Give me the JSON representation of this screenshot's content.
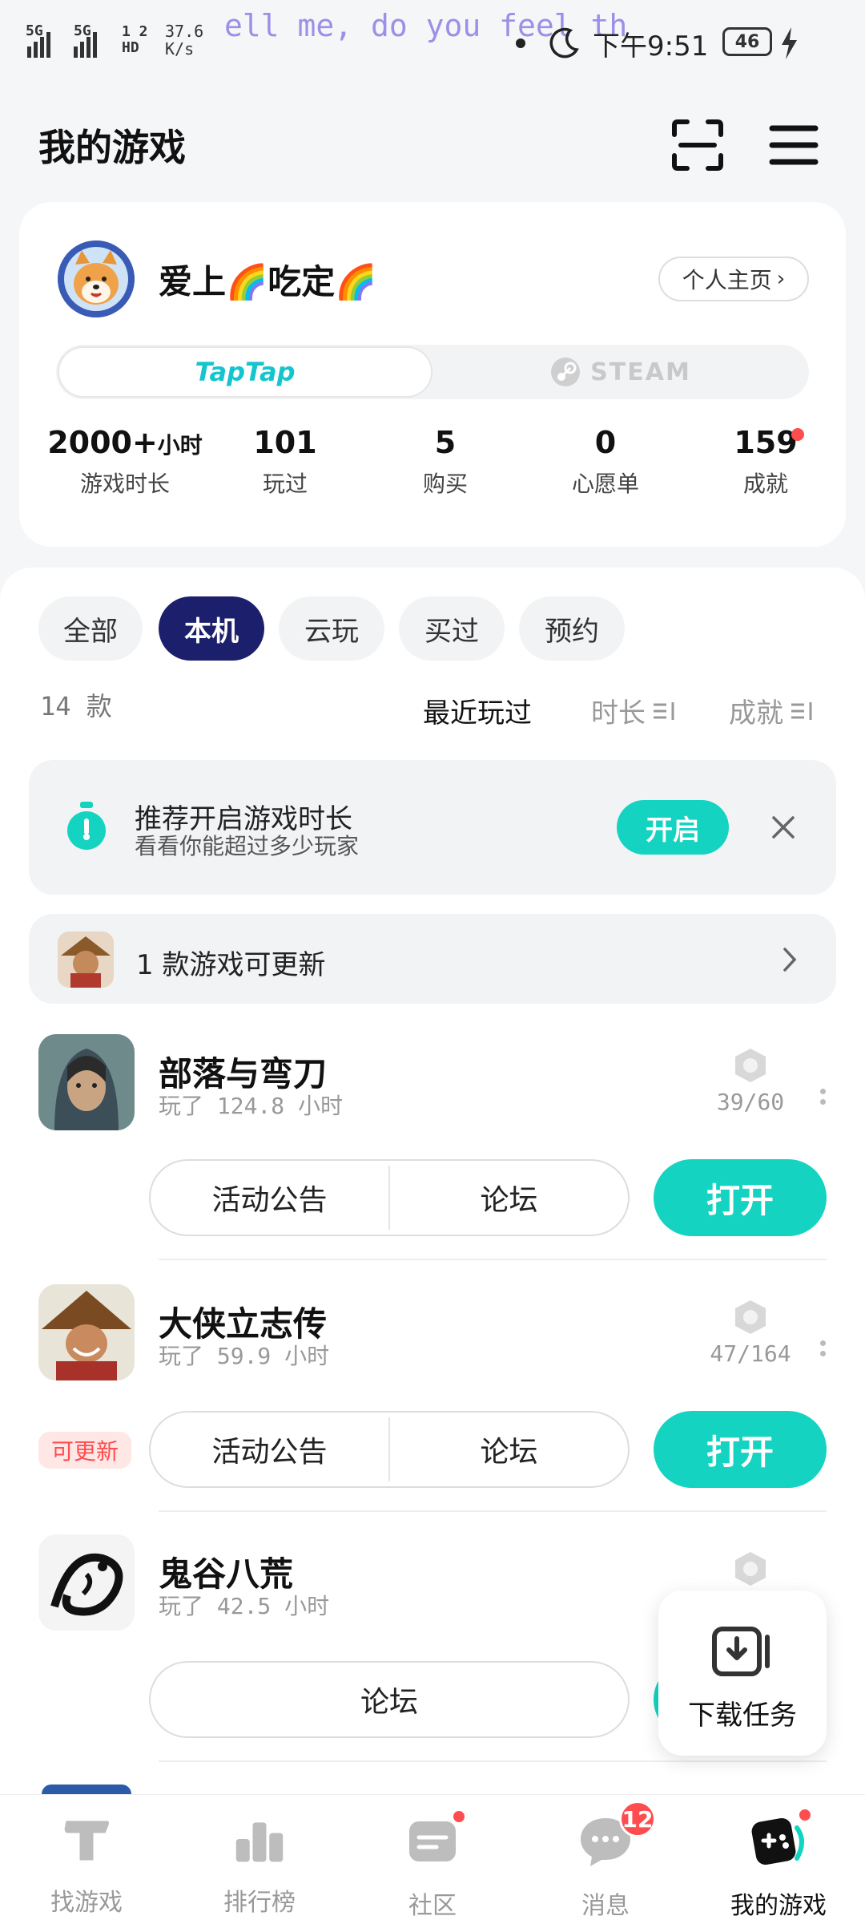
{
  "status_bar": {
    "signal_1": "5G",
    "signal_2": "5G",
    "hd": "1 2 HD",
    "net_speed": "37.6 K/s",
    "ticker": "ell me, do you feel th",
    "time": "下午9:51",
    "battery": "46"
  },
  "header": {
    "title": "我的游戏",
    "icons": [
      "scan-icon",
      "menu-icon"
    ]
  },
  "profile": {
    "username": "爱上🌈吃定🌈",
    "home_label": "个人主页",
    "tabs": {
      "taptap": "TapTap",
      "steam": "STEAM"
    },
    "stats": [
      {
        "value": "2000+",
        "unit": "小时",
        "label": "游戏时长"
      },
      {
        "value": "101",
        "unit": "",
        "label": "玩过"
      },
      {
        "value": "5",
        "unit": "",
        "label": "购买"
      },
      {
        "value": "0",
        "unit": "",
        "label": "心愿单"
      },
      {
        "value": "159",
        "unit": "",
        "label": "成就"
      }
    ]
  },
  "filters": [
    "全部",
    "本机",
    "云玩",
    "买过",
    "预约"
  ],
  "active_filter": "本机",
  "count_text": "14 款",
  "sort": {
    "recent": "最近玩过",
    "duration": "时长",
    "achievement": "成就"
  },
  "tip": {
    "title": "推荐开启游戏时长",
    "subtitle": "看看你能超过多少玩家",
    "button": "开启"
  },
  "update_banner": {
    "text": "1 款游戏可更新"
  },
  "games": [
    {
      "name": "部落与弯刀",
      "played": "玩了 124.8 小时",
      "achievements": "39/60",
      "btn1": "活动公告",
      "btn2": "论坛",
      "open": "打开"
    },
    {
      "name": "大侠立志传",
      "played": "玩了 59.9 小时",
      "achievements": "47/164",
      "btn1": "活动公告",
      "btn2": "论坛",
      "open": "打开",
      "badge": "可更新"
    },
    {
      "name": "鬼谷八荒",
      "played": "玩了 42.5 小时",
      "btn2": "论坛"
    }
  ],
  "download_fab": {
    "label": "下载任务"
  },
  "nav": [
    {
      "label": "找游戏",
      "icon": "find-games-icon"
    },
    {
      "label": "排行榜",
      "icon": "ranking-icon"
    },
    {
      "label": "社区",
      "icon": "community-icon"
    },
    {
      "label": "消息",
      "icon": "message-icon",
      "badge": "12"
    },
    {
      "label": "我的游戏",
      "icon": "my-games-icon"
    }
  ],
  "colors": {
    "accent": "#15d3c1",
    "active_chip": "#1c1f6b",
    "badge_red": "#ff4d4f"
  }
}
